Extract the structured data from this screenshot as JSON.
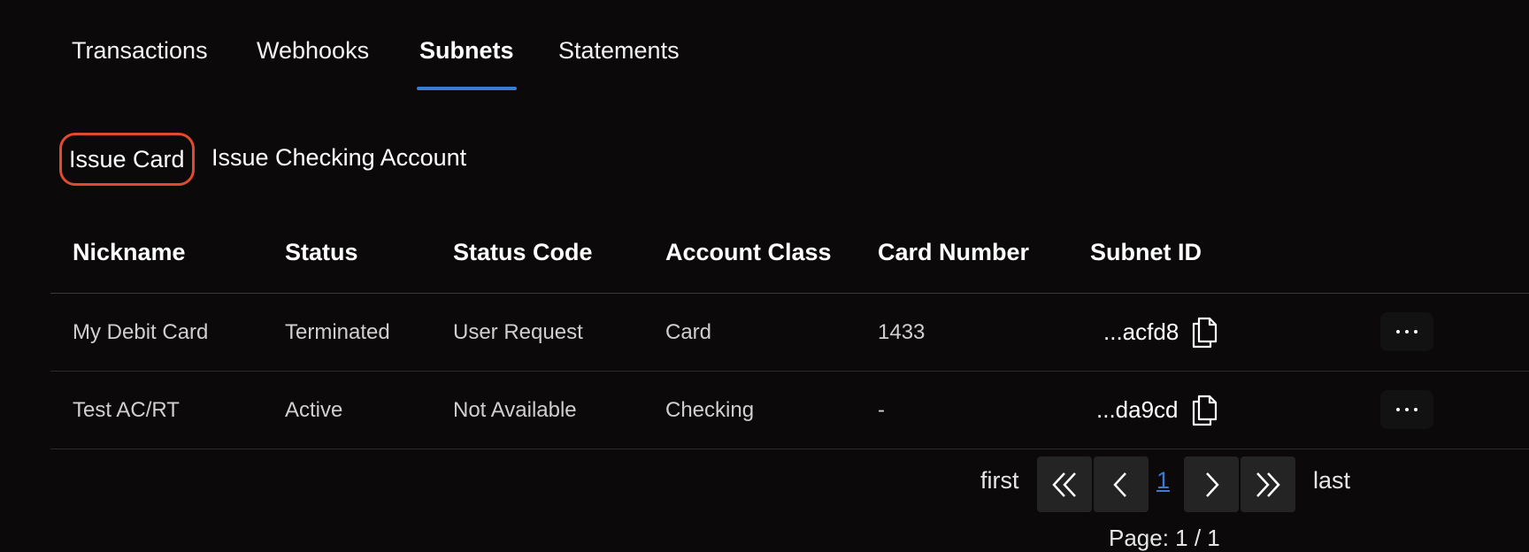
{
  "tabs": [
    {
      "label": "Transactions",
      "active": false
    },
    {
      "label": "Webhooks",
      "active": false
    },
    {
      "label": "Subnets",
      "active": true
    },
    {
      "label": "Statements",
      "active": false
    }
  ],
  "actions": {
    "issue_card": "Issue Card",
    "issue_checking": "Issue Checking Account"
  },
  "table": {
    "headers": [
      "Nickname",
      "Status",
      "Status Code",
      "Account Class",
      "Card Number",
      "Subnet ID"
    ],
    "rows": [
      {
        "nickname": "My Debit Card",
        "status": "Terminated",
        "status_code": "User Request",
        "account_class": "Card",
        "card_number": "1433",
        "subnet_id": "...acfd8"
      },
      {
        "nickname": "Test AC/RT",
        "status": "Active",
        "status_code": "Not Available",
        "account_class": "Checking",
        "card_number": "-",
        "subnet_id": "...da9cd"
      }
    ]
  },
  "pagination": {
    "first_label": "first",
    "last_label": "last",
    "current_page": "1",
    "page_info": "Page: 1 / 1"
  },
  "colors": {
    "background": "#0b090a",
    "accent": "#3a7bd5",
    "highlight": "#e04a2f"
  }
}
